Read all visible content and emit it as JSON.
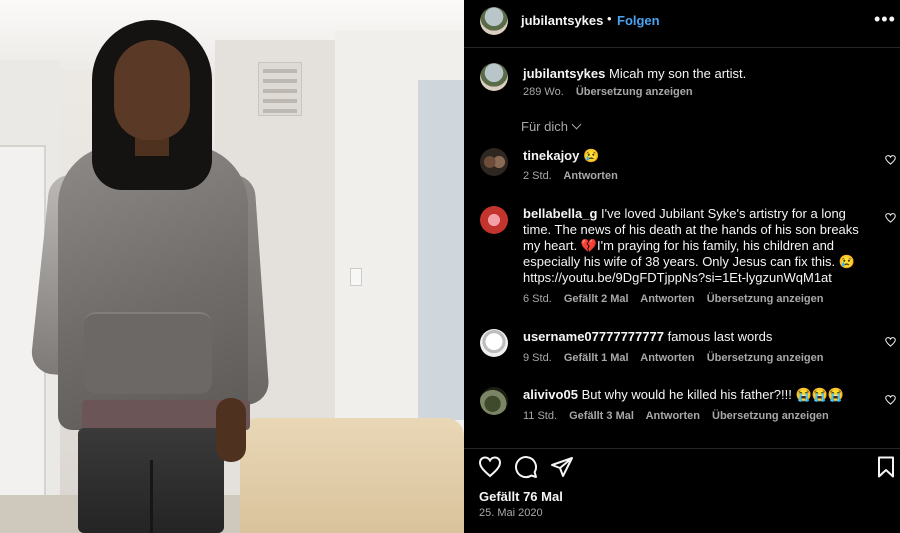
{
  "post": {
    "username": "jubilantsykes",
    "separator": "•",
    "follow_label": "Folgen",
    "more_icon": "more-horizontal-icon",
    "caption_user": "jubilantsykes",
    "caption_text": "Micah my son the artist.",
    "caption_age": "289 Wo.",
    "caption_translate": "Übersetzung anzeigen",
    "for_you_label": "Für dich",
    "likes": "Gefällt 76 Mal",
    "date": "25. Mai 2020"
  },
  "comments": [
    {
      "user": "tinekajoy",
      "text": "😢",
      "time": "2 Std.",
      "likes": "",
      "reply": "Antworten",
      "translate": ""
    },
    {
      "user": "bellabella_g",
      "text": "I've loved Jubilant Syke's artistry for a long time. The news of his death at the hands of his son breaks my heart. 💔I'm praying for his family, his children and especially his wife of 38 years. Only Jesus can fix this. 😢 https://youtu.be/9DgFDTjppNs?si=1Et-lygzunWqM1at",
      "time": "6 Std.",
      "likes": "Gefällt 2 Mal",
      "reply": "Antworten",
      "translate": "Übersetzung anzeigen"
    },
    {
      "user": "username07777777777",
      "text": "famous last words",
      "time": "9 Std.",
      "likes": "Gefällt 1 Mal",
      "reply": "Antworten",
      "translate": "Übersetzung anzeigen"
    },
    {
      "user": "alivivo05",
      "text": "But why would he killed his father?!!! 😭😭😭",
      "time": "11 Std.",
      "likes": "Gefällt 3 Mal",
      "reply": "Antworten",
      "translate": "Übersetzung anzeigen"
    }
  ],
  "icons": {
    "like": "heart-icon",
    "comment": "comment-icon",
    "share": "send-icon",
    "save": "bookmark-icon"
  },
  "colors": {
    "background": "#000000",
    "text": "#f5f5f5",
    "muted": "#a8a8a8",
    "link": "#4aa3f0"
  }
}
